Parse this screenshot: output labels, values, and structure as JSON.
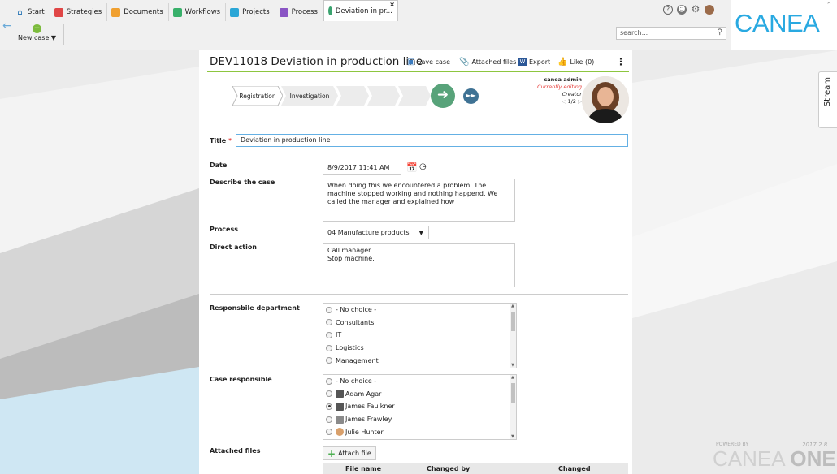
{
  "tabs": [
    {
      "label": "Start",
      "icon": "home-icon",
      "color": "#1e6fb3"
    },
    {
      "label": "Strategies",
      "icon": "strategies-icon",
      "color": "#e04646"
    },
    {
      "label": "Documents",
      "icon": "documents-icon",
      "color": "#f0a030"
    },
    {
      "label": "Workflows",
      "icon": "workflows-icon",
      "color": "#38b06a"
    },
    {
      "label": "Projects",
      "icon": "projects-icon",
      "color": "#2aa6d6"
    },
    {
      "label": "Process",
      "icon": "process-icon",
      "color": "#8a55c4"
    },
    {
      "label": "Deviation in pr...",
      "icon": "deviation-icon",
      "color": "#3aa36f"
    }
  ],
  "toolbar": {
    "new_case_label": "New case ▼"
  },
  "search": {
    "placeholder": "search..."
  },
  "logo": {
    "text": "CANEA",
    "color": "#29a9e1"
  },
  "case": {
    "title": "DEV11018 Deviation in production line",
    "actions": {
      "save": "Save case",
      "attached": "Attached files",
      "export": "Export",
      "like": "Like (0)"
    }
  },
  "workflow": {
    "steps": [
      "Registration",
      "Investigation"
    ],
    "accent": "#58a37a"
  },
  "person": {
    "name": "canea admin",
    "status": "Currently editing",
    "role": "Creator",
    "pager": "1/2"
  },
  "form": {
    "title_label": "Title",
    "title_value": "Deviation in production line",
    "date_label": "Date",
    "date_value": "8/9/2017 11:41 AM",
    "describe_label": "Describe the case",
    "describe_value": "When doing this we encountered a problem. The machine stopped working and nothing happend. We called the manager and explained how",
    "process_label": "Process",
    "process_value": "04 Manufacture products",
    "direct_label": "Direct action",
    "direct_value_1": "Call manager.",
    "direct_value_2": "Stop machine.",
    "dept_label": "Responsbile department",
    "dept_options": [
      "- No choice -",
      "Consultants",
      "IT",
      "Logistics",
      "Management"
    ],
    "resp_label": "Case responsible",
    "resp_options": [
      "- No choice -",
      "Adam Agar",
      "James Faulkner",
      "James Frawley",
      "Julie Hunter"
    ],
    "files_label": "Attached files",
    "attach_button": "Attach file",
    "table_headers": [
      "File name",
      "Changed by",
      "Changed"
    ]
  },
  "stream": {
    "label": "Stream"
  },
  "footer": {
    "powered": "POWERED BY",
    "version": "2017.2.8",
    "brand": "CANEA",
    "brand_bold": "ONE"
  }
}
